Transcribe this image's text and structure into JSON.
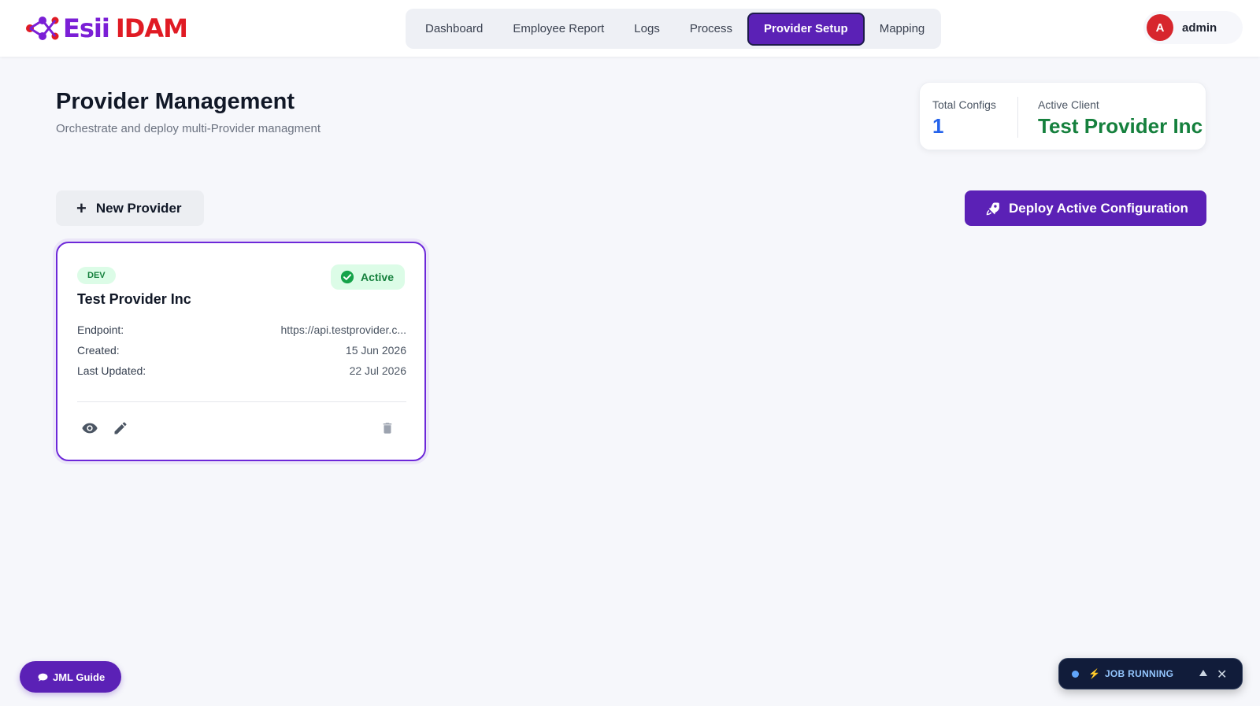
{
  "brand": {
    "part1": "Esii",
    "part2": "IDAM",
    "color1": "#7b1fd6",
    "color2": "#e01b24"
  },
  "nav": {
    "items": [
      {
        "label": "Dashboard"
      },
      {
        "label": "Employee Report"
      },
      {
        "label": "Logs"
      },
      {
        "label": "Process"
      },
      {
        "label": "Provider Setup",
        "active": true
      },
      {
        "label": "Mapping"
      }
    ]
  },
  "user": {
    "initial": "A",
    "name": "admin"
  },
  "header": {
    "title": "Provider Management",
    "subtitle": "Orchestrate and deploy multi-Provider managment"
  },
  "stats": {
    "total_configs_label": "Total Configs",
    "total_configs_value": "1",
    "active_client_label": "Active Client",
    "active_client_value": "Test Provider Inc"
  },
  "actions": {
    "new_provider": "New Provider",
    "deploy": "Deploy Active Configuration"
  },
  "card": {
    "env": "DEV",
    "status": "Active",
    "name": "Test Provider Inc",
    "rows": [
      {
        "label": "Endpoint:",
        "value": "https://api.testprovider.c..."
      },
      {
        "label": "Created:",
        "value": "15 Jun 2026"
      },
      {
        "label": "Last Updated:",
        "value": "22 Jul 2026"
      }
    ],
    "icons": [
      "eye-icon",
      "pencil-icon",
      "trash-icon"
    ]
  },
  "floating": {
    "guide": "JML Guide",
    "job_status": "JOB RUNNING"
  },
  "colors": {
    "accent": "#5b21b6",
    "success": "#15803d",
    "link": "#2563eb"
  }
}
